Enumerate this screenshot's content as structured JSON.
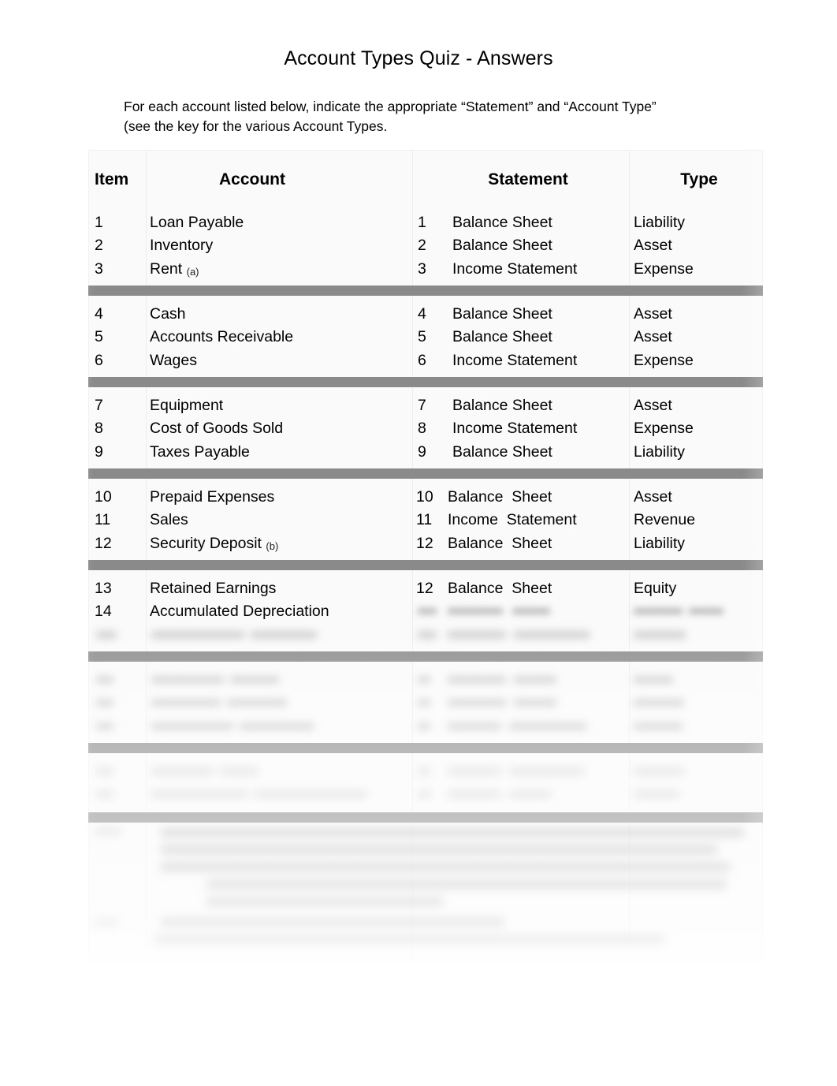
{
  "document": {
    "title": "Account Types Quiz - Answers",
    "intro_line1": "For each account listed below, indicate the appropriate “Statement” and “Account Type”",
    "intro_line2": "(see the key for the various Account Types."
  },
  "table": {
    "headers": {
      "item": "Item",
      "account": "Account",
      "statement": "Statement",
      "type": "Type"
    },
    "groups": [
      {
        "rows": [
          {
            "item": "1",
            "account": "Loan Payable",
            "note": "",
            "stmt_num": "1",
            "statement": "Balance Sheet",
            "type": "Liability"
          },
          {
            "item": "2",
            "account": "Inventory",
            "note": "",
            "stmt_num": "2",
            "statement": "Balance Sheet",
            "type": "Asset"
          },
          {
            "item": "3",
            "account": "Rent",
            "note": "(a)",
            "stmt_num": "3",
            "statement": "Income Statement",
            "type": "Expense"
          }
        ]
      },
      {
        "rows": [
          {
            "item": "4",
            "account": "Cash",
            "note": "",
            "stmt_num": "4",
            "statement": "Balance Sheet",
            "type": "Asset"
          },
          {
            "item": "5",
            "account": "Accounts Receivable",
            "note": "",
            "stmt_num": "5",
            "statement": "Balance Sheet",
            "type": "Asset"
          },
          {
            "item": "6",
            "account": "Wages",
            "note": "",
            "stmt_num": "6",
            "statement": "Income Statement",
            "type": "Expense"
          }
        ]
      },
      {
        "rows": [
          {
            "item": "7",
            "account": "Equipment",
            "note": "",
            "stmt_num": "7",
            "statement": "Balance Sheet",
            "type": "Asset"
          },
          {
            "item": "8",
            "account": "Cost of Goods Sold",
            "note": "",
            "stmt_num": "8",
            "statement": "Income Statement",
            "type": "Expense"
          },
          {
            "item": "9",
            "account": "Taxes Payable",
            "note": "",
            "stmt_num": "9",
            "statement": "Balance Sheet",
            "type": "Liability"
          }
        ]
      },
      {
        "wide": true,
        "rows": [
          {
            "item": "10",
            "account": "Prepaid Expenses",
            "note": "",
            "stmt_num": "10",
            "statement": "Balance  Sheet",
            "type": "Asset"
          },
          {
            "item": "11",
            "account": "Sales",
            "note": "",
            "stmt_num": "11",
            "statement": "Income  Statement",
            "type": "Revenue"
          },
          {
            "item": "12",
            "account": "Security Deposit",
            "note": "(b)",
            "stmt_num": "12",
            "statement": "Balance  Sheet",
            "type": "Liability"
          }
        ]
      },
      {
        "wide": true,
        "rows": [
          {
            "item": "13",
            "account": "Retained Earnings",
            "note": "",
            "stmt_num": "12",
            "statement": "Balance  Sheet",
            "type": "Equity"
          },
          {
            "item": "14",
            "account": "Accumulated Depreciation",
            "note": "",
            "stmt_num": "",
            "statement": "",
            "type": ""
          }
        ]
      }
    ]
  }
}
